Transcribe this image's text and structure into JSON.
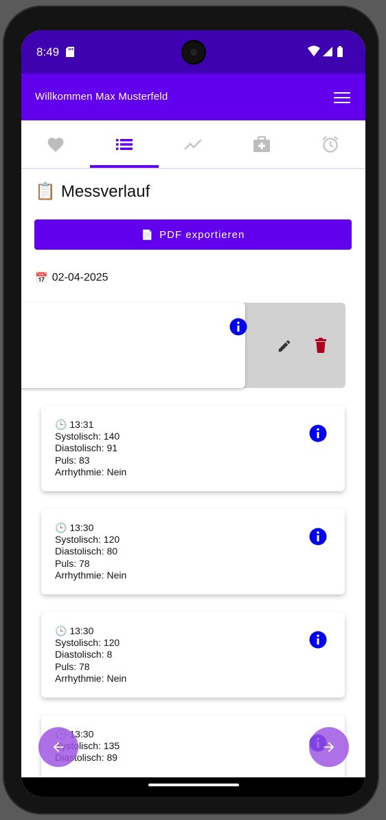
{
  "status": {
    "time": "8:49"
  },
  "appbar": {
    "title": "Willkommen Max Musterfeld"
  },
  "tabs": [
    {
      "name": "heart",
      "active": false
    },
    {
      "name": "list",
      "active": true
    },
    {
      "name": "chart",
      "active": false
    },
    {
      "name": "medical",
      "active": false
    },
    {
      "name": "alarm",
      "active": false
    }
  ],
  "page": {
    "title_icon": "📋",
    "title": "Messverlauf",
    "pdf_button_icon": "📄",
    "pdf_button_label": "PDF exportieren",
    "date_icon": "📅",
    "date": "02-04-2025"
  },
  "measurements": [
    {
      "clock": "🕒",
      "time": "13:31",
      "systolic": "Systolisch: 140",
      "diastolic": "Diastolisch: 91",
      "pulse": "Puls: 83",
      "arrhythmia": "Arrhythmie: Nein"
    },
    {
      "clock": "🕒",
      "time": "13:30",
      "systolic": "Systolisch: 120",
      "diastolic": "Diastolisch: 80",
      "pulse": "Puls: 78",
      "arrhythmia": "Arrhythmie: Nein"
    },
    {
      "clock": "🕒",
      "time": "13:30",
      "systolic": "Systolisch: 120",
      "diastolic": "Diastolisch: 8",
      "pulse": "Puls: 78",
      "arrhythmia": "Arrhythmie: Nein"
    },
    {
      "clock": "🕒",
      "time": "13:30",
      "systolic": "Systolisch: 135",
      "diastolic": "Diastolisch: 89"
    }
  ],
  "colors": {
    "primary": "#6200ee",
    "status_bar": "#3f02b0",
    "info_icon": "#0000ee",
    "delete_icon": "#b00020",
    "fab": "#9b51e0"
  }
}
